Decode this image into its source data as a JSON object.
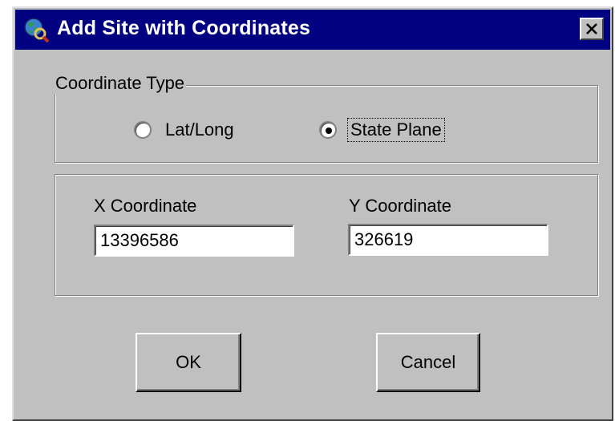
{
  "window": {
    "title": "Add Site with Coordinates",
    "app_icon": "globe-search-icon",
    "close_icon": "close-icon"
  },
  "coordinate_type": {
    "legend": "Coordinate Type",
    "options": [
      {
        "label": "Lat/Long",
        "selected": false
      },
      {
        "label": "State Plane",
        "selected": true
      }
    ]
  },
  "coordinates": {
    "x_label": "X Coordinate",
    "x_value": "13396586",
    "y_label": "Y Coordinate",
    "y_value": "326619"
  },
  "buttons": {
    "ok": "OK",
    "cancel": "Cancel"
  },
  "colors": {
    "titlebar": "#000080",
    "face": "#c0c0c0"
  }
}
